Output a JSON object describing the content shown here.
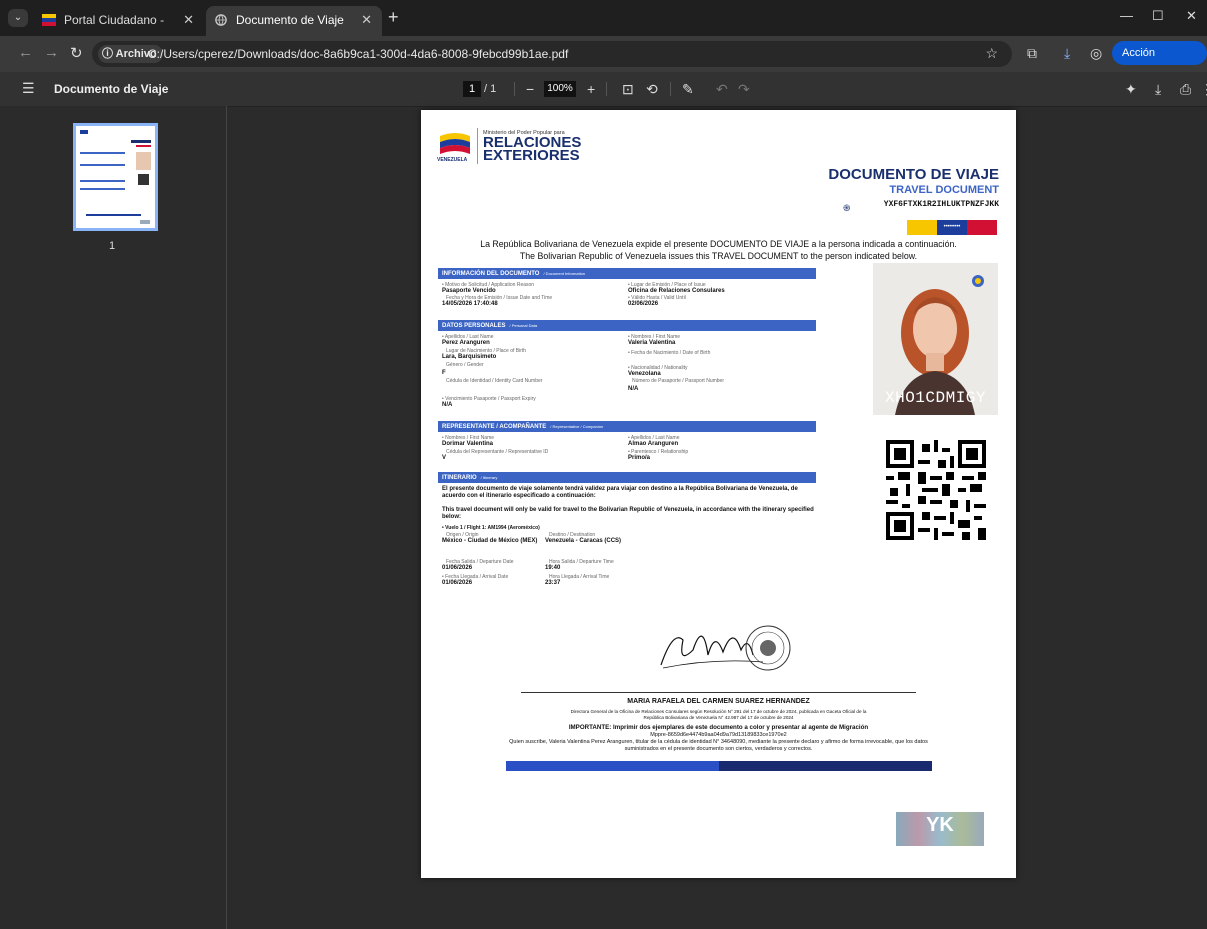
{
  "browser": {
    "tabs": [
      {
        "title": "Portal Ciudadano - Documento",
        "active": false
      },
      {
        "title": "Documento de Viaje",
        "active": true
      }
    ],
    "address": {
      "chip": "Archivo",
      "url": "C:/Users/cperez/Downloads/doc-8a6b9ca1-300d-4da6-8008-9febcd99b1ae.pdf"
    },
    "action_button": "Acción necesaria"
  },
  "pdf_toolbar": {
    "title": "Documento de Viaje",
    "page_current": "1",
    "page_total": "/ 1",
    "zoom": "100%"
  },
  "sidebar": {
    "thumbnail_number": "1"
  },
  "document": {
    "ministry_small": "Ministerio del Poder Popular para",
    "ministry_big1": "RELACIONES",
    "ministry_big2": "EXTERIORES",
    "country": "VENEZUELA",
    "title_es": "DOCUMENTO DE VIAJE",
    "title_en": "TRAVEL DOCUMENT",
    "code": "YXF6FTXK1R2IHLUKTPNZFJKK",
    "intro_es": "La República Bolivariana de Venezuela expide el presente DOCUMENTO DE VIAJE a la persona indicada a continuación.",
    "intro_en": "The Bolivarian Republic of Venezuela issues this TRAVEL DOCUMENT to the person indicated below.",
    "sections": {
      "info": {
        "title": "INFORMACIÓN DEL DOCUMENTO",
        "sub": "/ Document Information"
      },
      "personal": {
        "title": "DATOS PERSONALES",
        "sub": "/ Personal Data"
      },
      "rep": {
        "title": "REPRESENTANTE / ACOMPAÑANTE",
        "sub": "/ Representative / Companion"
      },
      "itin": {
        "title": "ITINERARIO",
        "sub": "/ Itinerary"
      }
    },
    "info": {
      "reason_label": "• Motivo de Solicitud / Application Reason",
      "reason": "Pasaporte Vencido",
      "place_label": "• Lugar de Emisión / Place of Issue",
      "place": "Oficina de Relaciones Consulares",
      "issue_label": "Fecha y Hora de Emisión / Issue Date and Time",
      "issue": "14/05/2026 17:40:48",
      "valid_label": "• Válido Hasta / Valid Until",
      "valid": "02/06/2026"
    },
    "personal": {
      "lastname_label": "• Apellidos / Last Name",
      "lastname": "Perez Aranguren",
      "firstname_label": "• Nombres / First Name",
      "firstname": "Valeria Valentina",
      "birthplace_label": "Lugar de Nacimiento / Place of Birth",
      "birthplace": "Lara, Barquisimeto",
      "birthdate_label": "• Fecha de Nacimiento / Date of Birth",
      "gender_label": "Género / Gender",
      "gender": "F",
      "nationality_label": "• Nacionalidad / Nationality",
      "nationality": "Venezolana",
      "id_label": "Cédula de Identidad / Identity Card Number",
      "passport_label": "Número de Pasaporte / Passport Number",
      "passport": "N/A",
      "expiry_label": "• Vencimiento Pasaporte / Passport Expiry",
      "expiry": "N/A"
    },
    "rep": {
      "firstname_label": "• Nombres / First Name",
      "firstname": "Dorimar Valentina",
      "lastname_label": "• Apellidos / Last Name",
      "lastname": "Almao Aranguren",
      "id_label": "Cédula del Representante / Representative ID",
      "id": "V",
      "relation_label": "• Parentesco / Relationship",
      "relation": "Primo/a"
    },
    "itin": {
      "notice_es": "El presente documento de viaje solamente tendrá validez para viajar con destino a la República Bolivariana de Venezuela, de acuerdo con el itinerario especificado a continuación:",
      "notice_en": "This travel document will only be valid for travel to the Bolivarian Republic of Venezuela, in accordance with the itinerary specified below:",
      "flight": "• Vuelo 1 / Flight 1: AM1994 (Aeroméxico)",
      "origin_label": "Origen / Origin",
      "origin": "México - Ciudad de México (MEX)",
      "dest_label": "Destino / Destination",
      "dest": "Venezuela - Caracas (CCS)",
      "dep_date_label": "Fecha Salida / Departure Date",
      "dep_date": "01/06/2026",
      "dep_time_label": "Hora Salida / Departure Time",
      "dep_time": "19:40",
      "arr_date_label": "• Fecha Llegada / Arrival Date",
      "arr_date": "01/06/2026",
      "arr_time_label": "Hora Llegada / Arrival Time",
      "arr_time": "23:37"
    },
    "photo_code": "XHO1CDMIGY",
    "signer": "MARIA RAFAELA DEL CARMEN SUAREZ HERNANDEZ",
    "signer_title1": "Directora General de la Oficina de Relaciones Consulares según Resolución N° 291 del 17 de octubre de 2024, publicada en Gaceta Oficial de la",
    "signer_title2": "República Bolivariana de Venezuela N° 42.987 del 17 de octubre de 2024",
    "important": "IMPORTANTE: Imprimir dos ejemplares de este documento a color y presentar al agente de Migración",
    "mppre": "Mppre-8659d6e4474b9aa04d9a79d13189833ce1970e2",
    "declaration1": "Quien suscribe, Valeria Valentina Perez Aranguren, titular de la cédula de identidad N° 34648090, mediante la presente declaro y afirmo de forma irrevocable, que los datos",
    "declaration2": "suministrados en el presente documento son ciertos, verdaderos y correctos.",
    "hologram": "YK"
  },
  "colors": {
    "accent": "#3b64c4",
    "navy": "#1a2f6e",
    "flag_yellow": "#f7c600",
    "flag_blue": "#1d3d9c",
    "flag_red": "#d21034",
    "action": "#0b57d0"
  }
}
